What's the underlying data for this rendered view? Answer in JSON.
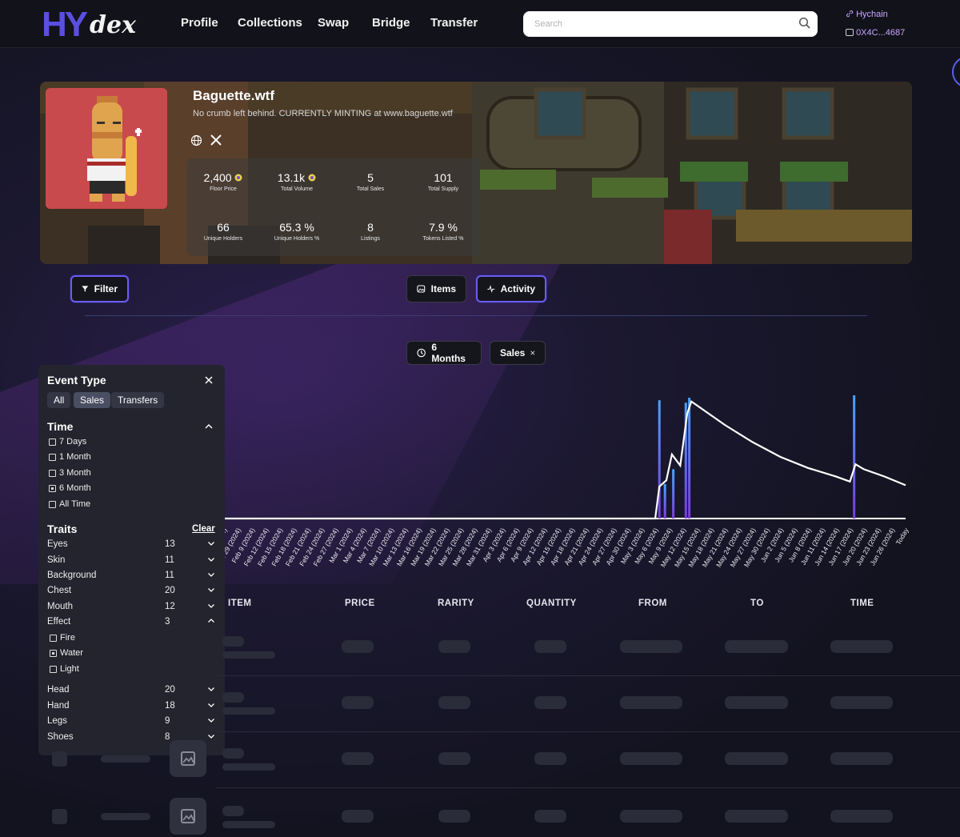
{
  "nav": {
    "logo_main": "HY",
    "logo_sub": "dex",
    "links": [
      "Profile",
      "Collections",
      "Swap",
      "Bridge",
      "Transfer"
    ],
    "search_placeholder": "Search",
    "chain": "Hychain",
    "wallet": "0X4C...4687"
  },
  "collection": {
    "name": "Baguette.wtf",
    "description": "No crumb left behind. CURRENTLY MINTING at www.baguette.wtf",
    "stats": [
      {
        "value": "2,400",
        "label": "Floor Price",
        "coin": true
      },
      {
        "value": "13.1k",
        "label": "Total Volume",
        "coin": true
      },
      {
        "value": "5",
        "label": "Total Sales",
        "coin": false
      },
      {
        "value": "101",
        "label": "Total Supply",
        "coin": false
      },
      {
        "value": "66",
        "label": "Unique Holders",
        "coin": false
      },
      {
        "value": "65.3 %",
        "label": "Unique Holders %",
        "coin": false
      },
      {
        "value": "8",
        "label": "Listings",
        "coin": false
      },
      {
        "value": "7.9 %",
        "label": "Tokens Listed %",
        "coin": false
      }
    ]
  },
  "toolbar": {
    "filter": "Filter",
    "items": "Items",
    "activity": "Activity",
    "range": "6 Months",
    "sales_chip": "Sales"
  },
  "panel": {
    "event_type_title": "Event Type",
    "event_types": [
      "All",
      "Sales",
      "Transfers"
    ],
    "time_title": "Time",
    "time_options": [
      {
        "label": "7 Days",
        "checked": false
      },
      {
        "label": "1 Month",
        "checked": false
      },
      {
        "label": "3 Month",
        "checked": false
      },
      {
        "label": "6 Month",
        "checked": true
      },
      {
        "label": "All Time",
        "checked": false
      }
    ],
    "traits_title": "Traits",
    "clear": "Clear",
    "traits": [
      {
        "name": "Eyes",
        "count": "13"
      },
      {
        "name": "Skin",
        "count": "11"
      },
      {
        "name": "Background",
        "count": "11"
      },
      {
        "name": "Chest",
        "count": "20"
      },
      {
        "name": "Mouth",
        "count": "12"
      },
      {
        "name": "Effect",
        "count": "3"
      }
    ],
    "effect_options": [
      {
        "label": "Fire",
        "checked": false
      },
      {
        "label": "Water",
        "checked": true
      },
      {
        "label": "Light",
        "checked": false
      }
    ],
    "traits_more": [
      {
        "name": "Head",
        "count": "20"
      },
      {
        "name": "Hand",
        "count": "18"
      },
      {
        "name": "Legs",
        "count": "9"
      },
      {
        "name": "Shoes",
        "count": "8"
      }
    ]
  },
  "table": {
    "headers": [
      "ITEM",
      "PRICE",
      "RARITY",
      "QUANTITY",
      "FROM",
      "TO",
      "TIME"
    ]
  },
  "chart_data": {
    "type": "line",
    "x_labels": [
      "Jan 26 (2024)",
      "Jan 29 (2024)",
      "Feb 9 (2024)",
      "Feb 12 (2024)",
      "Feb 15 (2024)",
      "Feb 18 (2024)",
      "Feb 21 (2024)",
      "Feb 24 (2024)",
      "Feb 27 (2024)",
      "Mar 1 (2024)",
      "Mar 4 (2024)",
      "Mar 7 (2024)",
      "Mar 10 (2024)",
      "Mar 13 (2024)",
      "Mar 16 (2024)",
      "Mar 19 (2024)",
      "Mar 22 (2024)",
      "Mar 25 (2024)",
      "Mar 28 (2024)",
      "Mar 31 (2024)",
      "Apr 3 (2024)",
      "Apr 6 (2024)",
      "Apr 9 (2024)",
      "Apr 12 (2024)",
      "Apr 15 (2024)",
      "Apr 18 (2024)",
      "Apr 21 (2024)",
      "Apr 24 (2024)",
      "Apr 27 (2024)",
      "Apr 30 (2024)",
      "May 3 (2024)",
      "May 6 (2024)",
      "May 9 (2024)",
      "May 12 (2024)",
      "May 15 (2024)",
      "May 18 (2024)",
      "May 21 (2024)",
      "May 24 (2024)",
      "May 27 (2024)",
      "May 30 (2024)",
      "Jun 2 (2024)",
      "Jun 5 (2024)",
      "Jun 8 (2024)",
      "Jun 11 (2024)",
      "Jun 14 (2024)",
      "Jun 17 (2024)",
      "Jun 20 (2024)",
      "Jun 23 (2024)",
      "Jun 26 (2024)",
      "Today"
    ],
    "bars": [
      {
        "index": 31.3,
        "value": 0.96
      },
      {
        "index": 31.7,
        "value": 0.28
      },
      {
        "index": 32.3,
        "value": 0.4
      },
      {
        "index": 33.2,
        "value": 0.94
      },
      {
        "index": 33.45,
        "value": 0.98
      },
      {
        "index": 45.3,
        "value": 1.0
      }
    ],
    "line": [
      [
        0,
        0
      ],
      [
        31.0,
        0
      ],
      [
        31.3,
        0.26
      ],
      [
        31.8,
        0.31
      ],
      [
        32.2,
        0.52
      ],
      [
        32.8,
        0.43
      ],
      [
        33.3,
        0.85
      ],
      [
        33.6,
        0.95
      ],
      [
        36,
        0.76
      ],
      [
        38,
        0.62
      ],
      [
        40,
        0.5
      ],
      [
        42,
        0.41
      ],
      [
        44,
        0.34
      ],
      [
        45.0,
        0.3
      ],
      [
        45.4,
        0.44
      ],
      [
        46,
        0.4
      ],
      [
        47.5,
        0.34
      ],
      [
        49,
        0.27
      ]
    ]
  }
}
